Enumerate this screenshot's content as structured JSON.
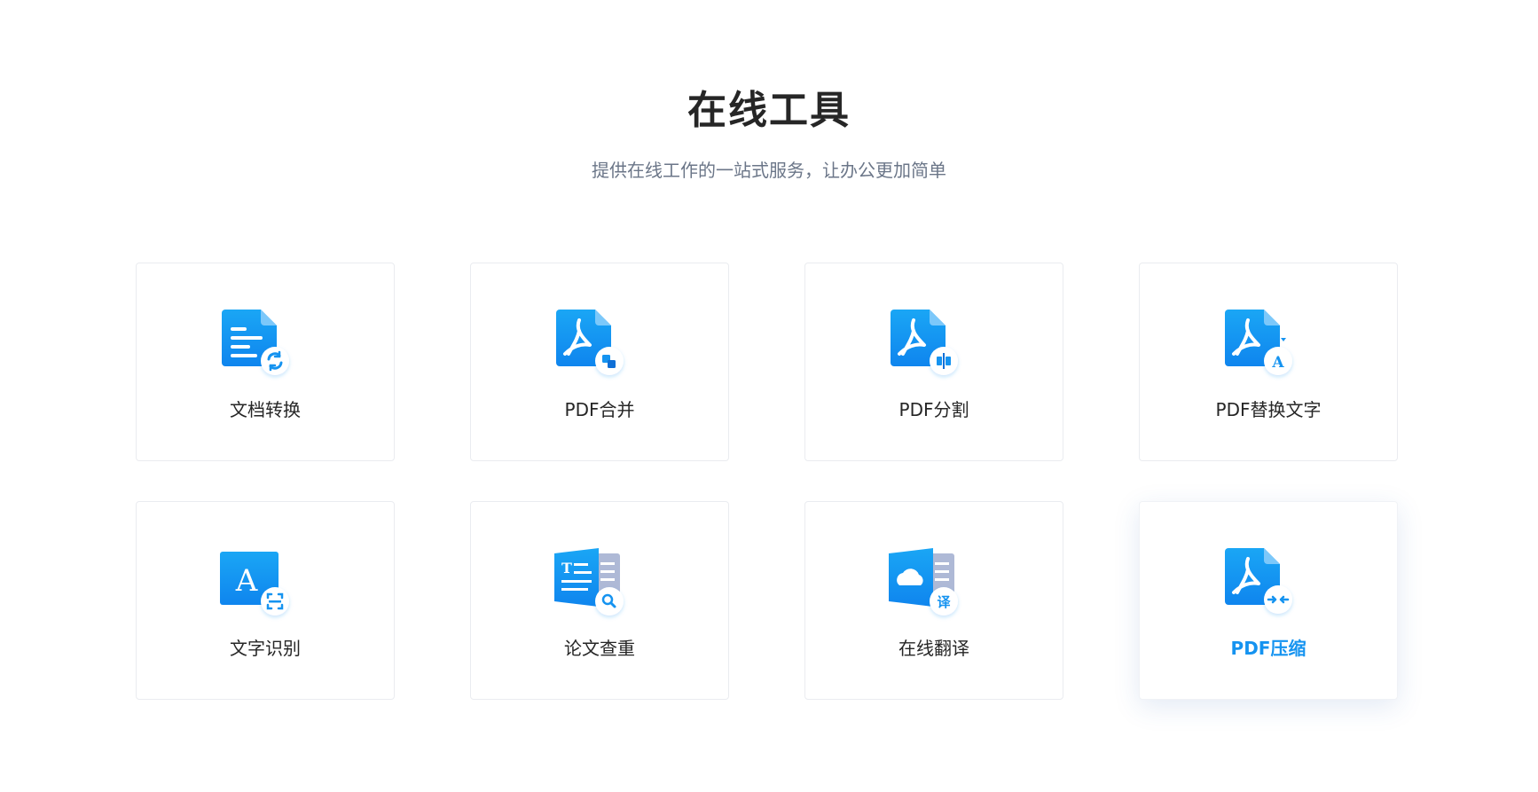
{
  "header": {
    "title": "在线工具",
    "subtitle": "提供在线工作的一站式服务，让办公更加简单"
  },
  "colors": {
    "accent": "#1593f0",
    "icon_gradient_top": "#1aa6f5",
    "icon_gradient_bottom": "#0f85ee",
    "secondary_page": "#aeb9d6"
  },
  "tools": [
    {
      "label": "文档转换",
      "icon": "document-convert-icon"
    },
    {
      "label": "PDF合并",
      "icon": "pdf-merge-icon"
    },
    {
      "label": "PDF分割",
      "icon": "pdf-split-icon"
    },
    {
      "label": "PDF替换文字",
      "icon": "pdf-replace-text-icon"
    },
    {
      "label": "文字识别",
      "icon": "text-recognition-icon"
    },
    {
      "label": "论文查重",
      "icon": "paper-check-icon"
    },
    {
      "label": "在线翻译",
      "icon": "online-translate-icon"
    },
    {
      "label": "PDF压缩",
      "icon": "pdf-compress-icon",
      "active": true
    }
  ]
}
